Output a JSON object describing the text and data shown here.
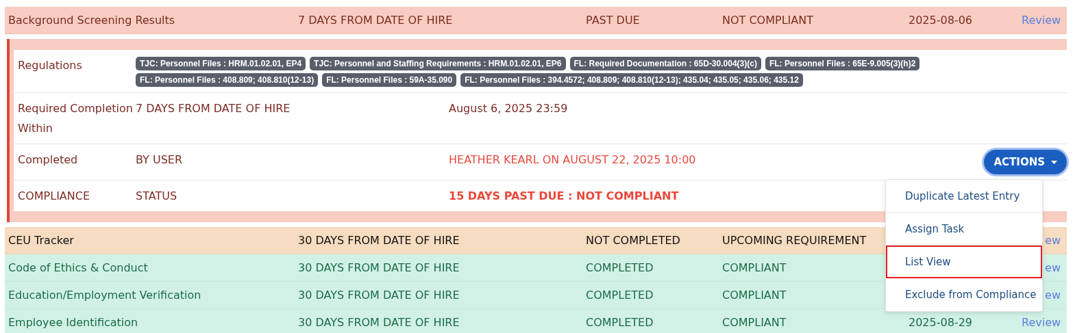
{
  "top_rows": [
    {
      "kind": "overdue",
      "name": "Background Screening Results",
      "due": "7 DAYS FROM DATE OF HIRE",
      "status": "PAST DUE",
      "compliance": "NOT COMPLIANT",
      "date": "2025-08-06",
      "link": "Review"
    }
  ],
  "detail": {
    "regulations_label": "Regulations",
    "regulations": [
      "TJC: Personnel Files : HRM.01.02.01, EP4",
      "TJC: Personnel and Staffing Requirements : HRM.01.02.01, EP6",
      "FL: Required Documentation : 65D-30.004(3)(c)",
      "FL: Personnel Files : 65E-9.005(3)(h)2",
      "FL: Personnel Files : 408.809; 408.810(12-13)",
      "FL: Personnel Files : 59A-35.090",
      "FL: Personnel Files : 394.4572; 408.809; 408.810(12-13); 435.04; 435.05; 435.06; 435.12"
    ],
    "required_label": "Required Completion Within",
    "required_value": "7 DAYS FROM DATE OF HIRE",
    "required_deadline": "August 6, 2025 23:59",
    "completed_label": "Completed",
    "completed_value": "BY USER",
    "completed_by": "HEATHER KEARL ON AUGUST 22, 2025 10:00",
    "compliance_label": "COMPLIANCE",
    "compliance_value": "STATUS",
    "compliance_result": "15 DAYS PAST DUE : NOT COMPLIANT"
  },
  "actions_button": "ACTIONS",
  "menu": [
    {
      "label": "Duplicate Latest Entry",
      "selected": false
    },
    {
      "label": "Assign Task",
      "selected": false
    },
    {
      "label": "List View",
      "selected": true
    },
    {
      "label": "Exclude from Compliance",
      "selected": false
    }
  ],
  "rows": [
    {
      "kind": "upcoming",
      "name": "CEU Tracker",
      "due": "30 DAYS FROM DATE OF HIRE",
      "status": "NOT COMPLETED",
      "compliance": "UPCOMING REQUIREMENT",
      "link": "ew"
    },
    {
      "kind": "compliant",
      "name": "Code of Ethics & Conduct",
      "due": "30 DAYS FROM DATE OF HIRE",
      "status": "COMPLETED",
      "compliance": "COMPLIANT",
      "link": "ew"
    },
    {
      "kind": "compliant",
      "name": "Education/Employment Verification",
      "due": "30 DAYS FROM DATE OF HIRE",
      "status": "COMPLETED",
      "compliance": "COMPLIANT",
      "link": "ew"
    },
    {
      "kind": "compliant",
      "name": "Employee Identification",
      "due": "30 DAYS FROM DATE OF HIRE",
      "status": "COMPLETED",
      "compliance": "COMPLIANT",
      "date": "2025-08-29",
      "link": "Review"
    }
  ]
}
